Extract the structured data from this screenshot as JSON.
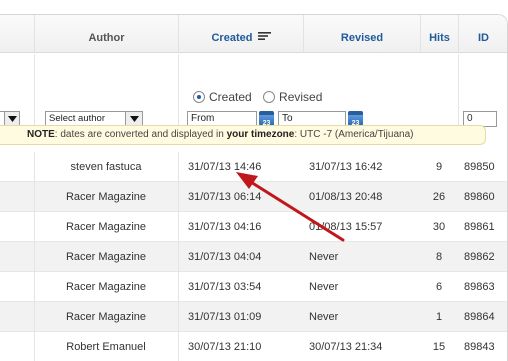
{
  "columns": {
    "author": "Author",
    "created": "Created",
    "revised": "Revised",
    "hits": "Hits",
    "id": "ID"
  },
  "filters": {
    "author_select": "Select author",
    "created_radio": "Created",
    "revised_radio": "Revised",
    "from_value": "From",
    "to_value": "To",
    "calendar_label": "23",
    "id_value": "0"
  },
  "note": {
    "prefix": "NOTE",
    "text1": ": dates are converted and displayed in ",
    "emph": "your timezone",
    "text2": ": UTC -7 (America/Tijuana)"
  },
  "rows": [
    {
      "author": "steven fastuca",
      "created": "31/07/13 14:46",
      "revised": "31/07/13 16:42",
      "hits": "9",
      "id": "89850"
    },
    {
      "author": "Racer Magazine",
      "created": "31/07/13 06:14",
      "revised": "01/08/13 20:48",
      "hits": "26",
      "id": "89860"
    },
    {
      "author": "Racer Magazine",
      "created": "31/07/13 04:16",
      "revised": "01/08/13 15:57",
      "hits": "30",
      "id": "89861"
    },
    {
      "author": "Racer Magazine",
      "created": "31/07/13 04:04",
      "revised": "Never",
      "hits": "8",
      "id": "89862"
    },
    {
      "author": "Racer Magazine",
      "created": "31/07/13 03:54",
      "revised": "Never",
      "hits": "6",
      "id": "89863"
    },
    {
      "author": "Racer Magazine",
      "created": "31/07/13 01:09",
      "revised": "Never",
      "hits": "1",
      "id": "89864"
    },
    {
      "author": "Robert Emanuel",
      "created": "30/07/13 21:10",
      "revised": "30/07/13 21:34",
      "hits": "15",
      "id": "89843"
    }
  ],
  "colors": {
    "link": "#1f5a99",
    "arrow": "#c0171c",
    "note_bg": "#fffbe0"
  },
  "icons": [
    "sort-icon",
    "calendar-icon",
    "dropdown-arrow-icon",
    "annotation-arrow"
  ]
}
